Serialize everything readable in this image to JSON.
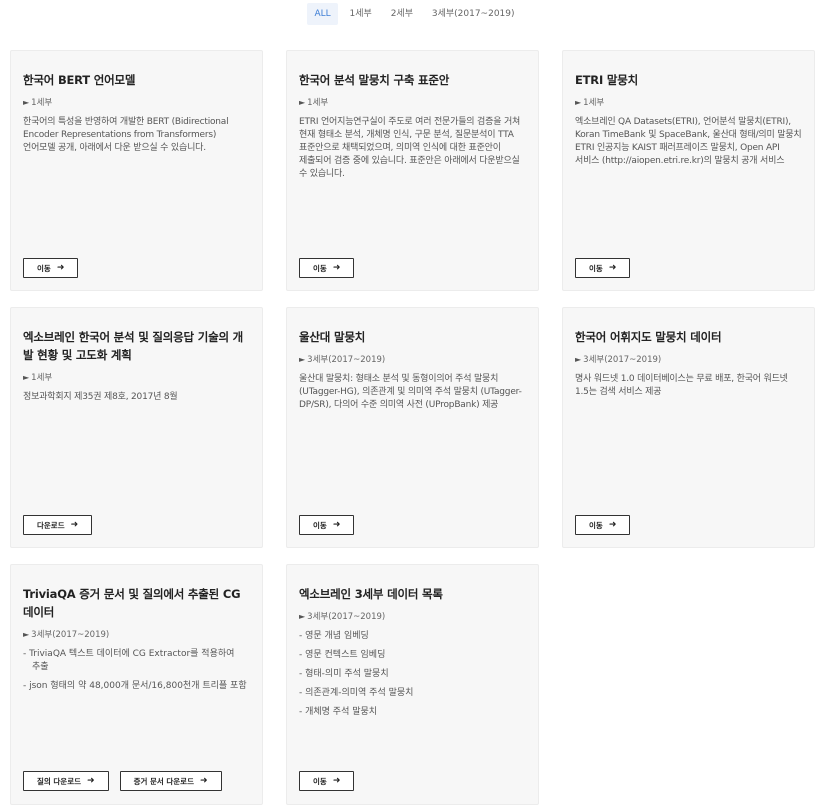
{
  "filters": [
    {
      "label": "ALL",
      "active": true
    },
    {
      "label": "1세부",
      "active": false
    },
    {
      "label": "2세부",
      "active": false
    },
    {
      "label": "3세부(2017~2019)",
      "active": false
    }
  ],
  "arrow_icon": "arrow-right-icon",
  "tag_icon": "tag-icon",
  "cards": [
    {
      "title": "한국어 BERT 언어모델",
      "tag": "1세부",
      "desc": "한국어의 특성을 반영하여 개발한 BERT (Bidirectional Encoder Representations from Transformers) 언어모델 공개, 아래에서 다운 받으실 수 있습니다.",
      "buttons": [
        "이동"
      ]
    },
    {
      "title": "한국어 분석 말뭉치 구축 표준안",
      "tag": "1세부",
      "desc": "ETRI 언어지능연구실이 주도로 여러 전문가들의 검증을 거쳐 현재 형태소 분석, 개체명 인식, 구문 분석, 질문분석이 TTA 표준안으로 채택되었으며, 의미역 인식에 대한 표준안이 제출되어 검증 중에 있습니다. 표준안은 아래에서 다운받으실 수 있습니다.",
      "buttons": [
        "이동"
      ]
    },
    {
      "title": "ETRI 말뭉치",
      "tag": "1세부",
      "desc": "엑소브레인 QA Datasets(ETRI), 언어분석 말뭉치(ETRI), Koran TimeBank 및 SpaceBank, 울산대 형태/의미 말뭉치 ETRI 인공지능 KAIST 패러프레이즈 말뭉치, Open API 서비스 (http://aiopen.etri.re.kr)의 말뭉치 공개 서비스",
      "buttons": [
        "이동"
      ]
    },
    {
      "title": "엑소브레인 한국어 분석 및 질의응답 기술의 개발 현황 및 고도화 계획",
      "tag": "1세부",
      "desc": "정보과학회지 제35권 제8호, 2017년 8월",
      "buttons": [
        "다운로드"
      ]
    },
    {
      "title": "울산대 말뭉치",
      "tag": "3세부(2017~2019)",
      "desc": "울산대 말뭉치: 형태소 분석 및 동형이의어 주석 말뭉치 (UTagger-HG), 의존관계 및 의미역 주석 말뭉치 (UTagger-DP/SR), 다의어 수준 의미역 사전 (UPropBank) 제공",
      "buttons": [
        "이동"
      ]
    },
    {
      "title": "한국어 어휘지도 말뭉치 데이터",
      "tag": "3세부(2017~2019)",
      "desc": "명사 워드넷 1.0 데이터베이스는 무료 배포, 한국어 워드넷 1.5는 검색 서비스 제공",
      "buttons": [
        "이동"
      ]
    },
    {
      "title": "TriviaQA 증거 문서 및 질의에서 추출된 CG 데이터",
      "tag": "3세부(2017~2019)",
      "list": [
        "TriviaQA 텍스트 데이터에 CG Extractor를 적용하여 추출",
        "json 형태의 약 48,000개 문서/16,800천개 트리플 포함"
      ],
      "buttons": [
        "질의 다운로드",
        "증거 문서 다운로드"
      ]
    },
    {
      "title": "엑소브레인 3세부 데이터 목록",
      "tag": "3세부(2017~2019)",
      "list": [
        "영문 개념 임베딩",
        "영문 컨텍스트 임베딩",
        "형태-의미 주석 말뭉치",
        "의존관계-의미역 주석 말뭉치",
        "개체명 주석 말뭉치"
      ],
      "buttons": [
        "이동"
      ]
    }
  ]
}
